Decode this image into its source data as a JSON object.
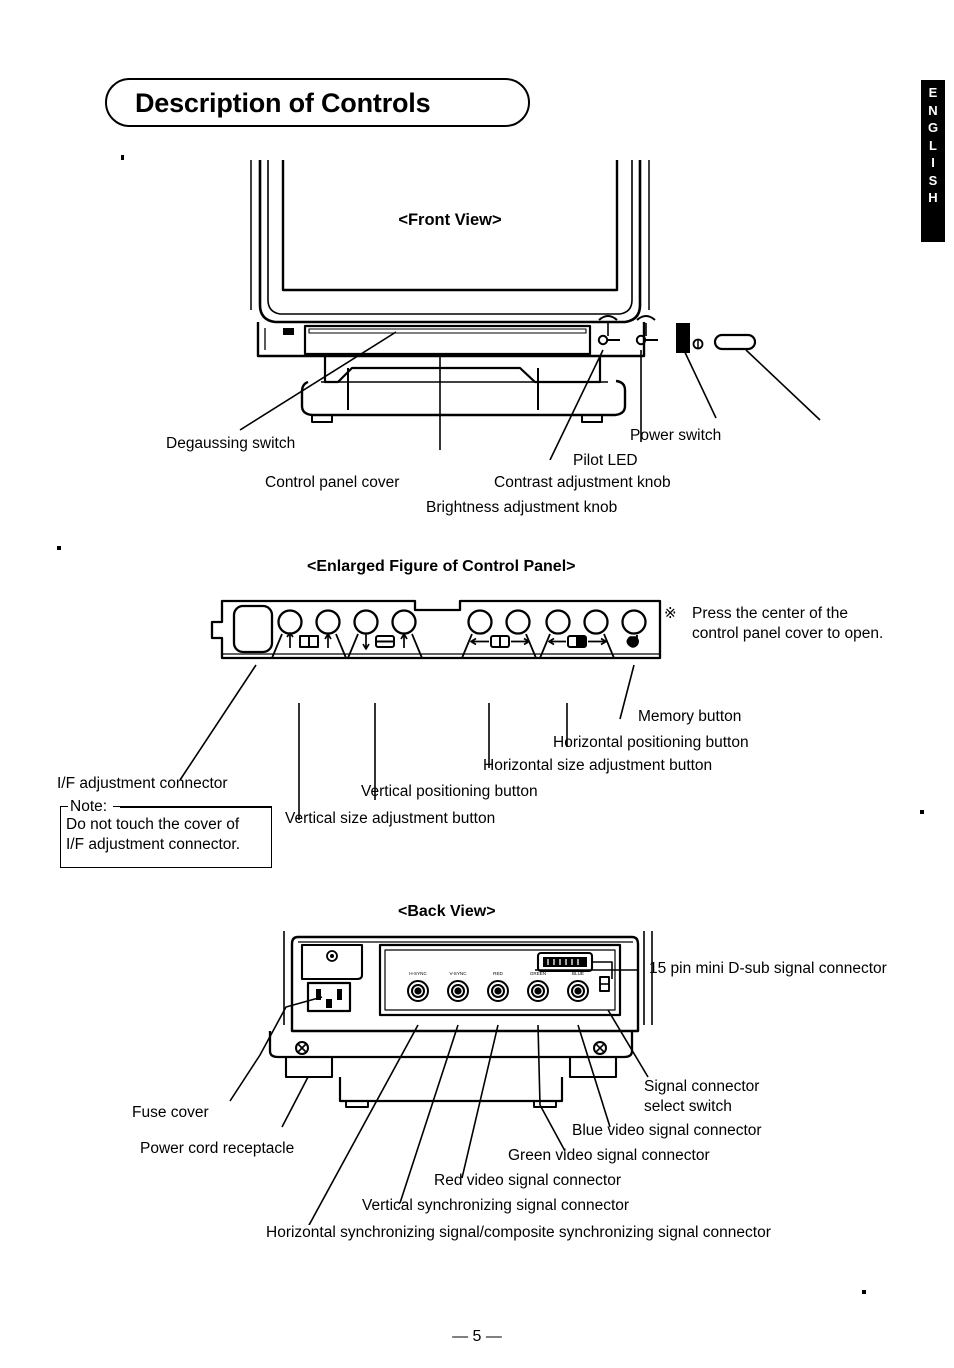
{
  "document": {
    "title": "Description of Controls",
    "side_tab": [
      "E",
      "N",
      "G",
      "L",
      "I",
      "S",
      "H"
    ],
    "page_number": "— 5 —"
  },
  "front_view": {
    "caption": "<Front View>",
    "callouts": [
      {
        "id": "degaussing-switch",
        "label": "Degaussing switch"
      },
      {
        "id": "control-panel-cover",
        "label": "Control panel cover"
      },
      {
        "id": "brightness-adjustment-knob",
        "label": "Brightness adjustment knob"
      },
      {
        "id": "contrast-adjustment-knob",
        "label": "Contrast adjustment knob"
      },
      {
        "id": "pilot-led",
        "label": "Pilot LED"
      },
      {
        "id": "power-switch",
        "label": "Power switch"
      }
    ]
  },
  "control_panel": {
    "caption": "<Enlarged Figure of Control Panel>",
    "note_mark": "※",
    "note_line1": "Press the center of the",
    "note_line2": "control panel cover to open.",
    "callouts": [
      {
        "id": "if-adjustment-connector",
        "label": "I/F adjustment connector"
      },
      {
        "id": "vertical-size-adjustment",
        "label": "Vertical size adjustment button"
      },
      {
        "id": "vertical-positioning",
        "label": "Vertical positioning button"
      },
      {
        "id": "horizontal-size-adjustment",
        "label": "Horizontal size adjustment button"
      },
      {
        "id": "horizontal-positioning",
        "label": "Horizontal positioning button"
      },
      {
        "id": "memory-button",
        "label": "Memory button"
      }
    ],
    "note_box": {
      "legend": "Note:",
      "line1": "Do not touch the cover of",
      "line2": "I/F adjustment connector."
    }
  },
  "back_view": {
    "caption": "<Back View>",
    "connector_marks": [
      "H-SYNC",
      "V-SYNC",
      "RED",
      "GREEN",
      "BLUE"
    ],
    "callouts": [
      {
        "id": "dsub-connector",
        "label": "15 pin mini D-sub signal connector"
      },
      {
        "id": "signal-select-switch-1",
        "label": "Signal connector"
      },
      {
        "id": "signal-select-switch-2",
        "label": "select switch"
      },
      {
        "id": "blue-video-connector",
        "label": "Blue video signal connector"
      },
      {
        "id": "green-video-connector",
        "label": "Green video signal connector"
      },
      {
        "id": "red-video-connector",
        "label": "Red video signal connector"
      },
      {
        "id": "vsync-connector",
        "label": "Vertical synchronizing signal connector"
      },
      {
        "id": "hsync-connector",
        "label": "Horizontal synchronizing signal/composite synchronizing signal connector"
      },
      {
        "id": "fuse-cover",
        "label": "Fuse cover"
      },
      {
        "id": "power-cord-receptacle",
        "label": "Power cord receptacle"
      }
    ]
  }
}
